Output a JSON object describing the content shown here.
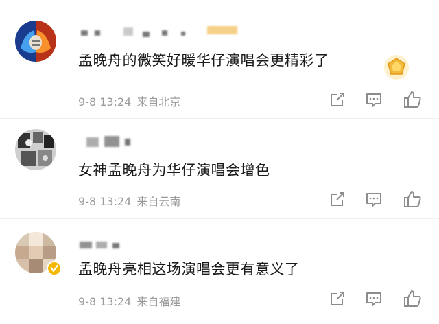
{
  "comments": [
    {
      "text": "孟晚舟的微笑好暖华仔演唱会更精彩了",
      "time": "9-8 13:24",
      "location": "来自北京",
      "avatar_icon": "fire-ice-fist-avatar",
      "badge_icon": "gold-fan-badge-icon"
    },
    {
      "text": "女神孟晚舟为华仔演唱会增色",
      "time": "9-8 13:24",
      "location": "来自云南",
      "avatar_icon": "monochrome-collage-avatar"
    },
    {
      "text": "孟晚舟亮相这场演唱会更有意义了",
      "time": "9-8 13:24",
      "location": "来自福建",
      "avatar_icon": "pixelated-avatar",
      "verified_icon": "verified-v-badge-icon"
    }
  ],
  "actions": [
    "share-icon",
    "comment-icon",
    "like-icon"
  ],
  "colors": {
    "text": "#1a1a1a",
    "meta": "#9a9a9a",
    "icon": "#8c8c8c",
    "gold": "#f3b93b",
    "verified": "#f5b800"
  }
}
